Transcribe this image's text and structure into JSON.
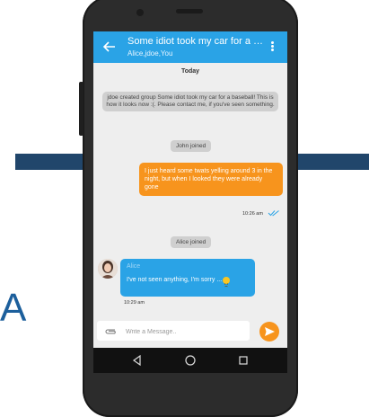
{
  "colors": {
    "appbar": "#2aa3e6",
    "outgoing_bubble": "#f7941d",
    "incoming_bubble": "#2aa3e6",
    "system_bubble": "#cfcfcf",
    "send_button": "#f7941d",
    "check_marks": "#2aa3e6"
  },
  "appbar": {
    "title": "Some idiot took my car for a b...",
    "subtitle": "Alice,jdoe,You",
    "back_icon": "arrow-left-icon",
    "menu_icon": "more-vertical-icon"
  },
  "chat": {
    "date_label": "Today",
    "system_group_created": "jdoe created group Some idiot took my car for a baseball! This is how it looks now :(. Please contact me, if you've seen something.",
    "system_john_joined": "John joined",
    "outgoing_message": {
      "text": "I just heard some twats yelling around 3 in the night, but when I looked they were already gone",
      "time": "10:26 am",
      "status_icon": "double-check-icon"
    },
    "system_alice_joined": "Alice joined",
    "incoming_message": {
      "sender": "Alice",
      "text": "I've not seen anything, I'm sorry ...",
      "emoji": "sad-face-emoji",
      "time": "10:29 am"
    }
  },
  "composer": {
    "placeholder": "Write a Message..",
    "attach_icon": "paperclip-icon",
    "send_icon": "send-icon"
  },
  "navigation": {
    "back": "triangle-back-icon",
    "home": "circle-home-icon",
    "recents": "square-recents-icon"
  }
}
